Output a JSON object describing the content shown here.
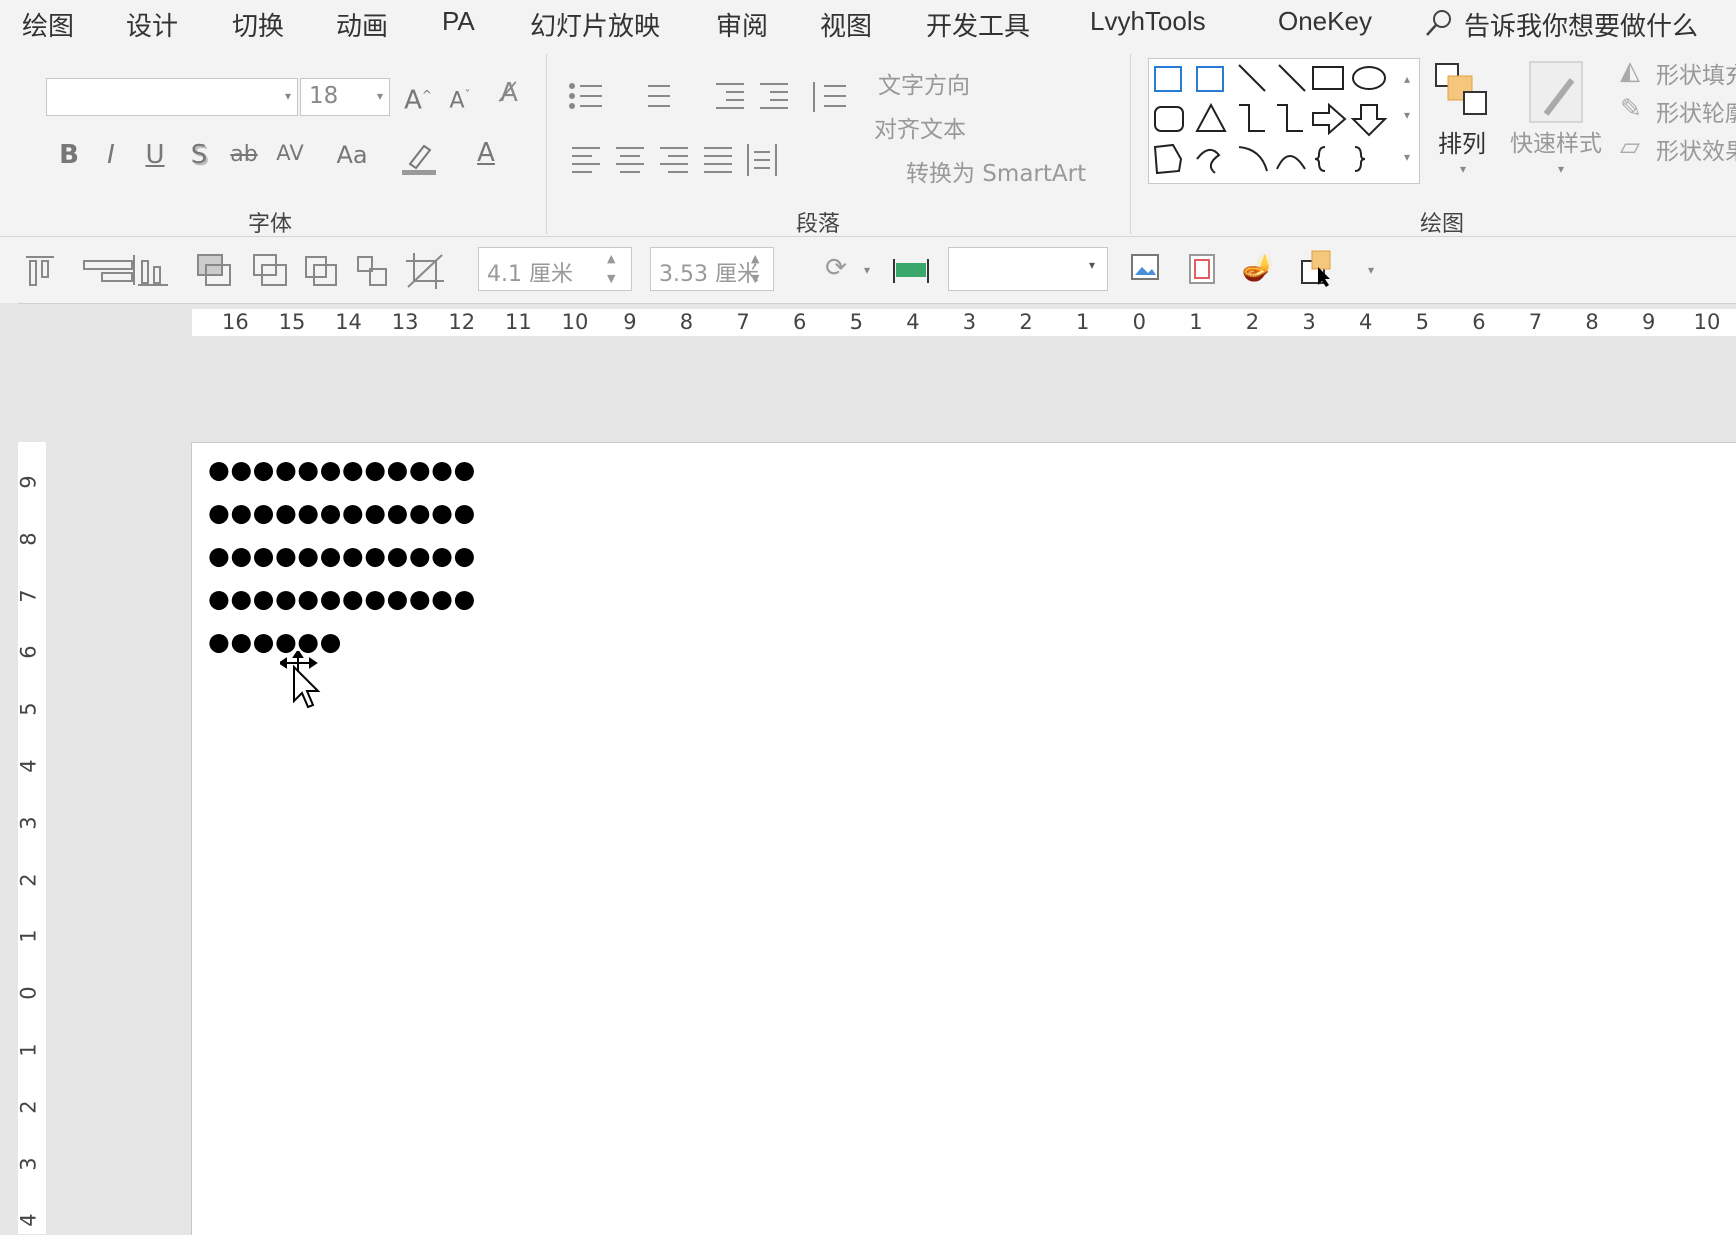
{
  "tabs": [
    "绘图",
    "设计",
    "切换",
    "动画",
    "PA",
    "幻灯片放映",
    "审阅",
    "视图",
    "开发工具",
    "LvyhTools",
    "OneKey"
  ],
  "tell_me": "告诉我你想要做什么",
  "font_group": {
    "font_name": "",
    "font_size": "18",
    "label": "字体",
    "buttons": [
      "B",
      "I",
      "U",
      "S",
      "ab",
      "AV",
      "Aa",
      "A"
    ]
  },
  "paragraph_group": {
    "label": "段落",
    "text_direction": "文字方向",
    "align_text": "对齐文本",
    "smartart": "转换为 SmartArt"
  },
  "drawing_group": {
    "label": "绘图",
    "arrange": "排列",
    "quick_styles": "快速样式",
    "shape_fill": "形状填充",
    "shape_outline": "形状轮廓",
    "shape_effects": "形状效果"
  },
  "format_bar": {
    "height_value": "4.1 厘米",
    "width_value": "3.53 厘米",
    "dropdown_value": ""
  },
  "hruler_labels": [
    "16",
    "15",
    "14",
    "13",
    "12",
    "11",
    "10",
    "9",
    "8",
    "7",
    "6",
    "5",
    "4",
    "3",
    "2",
    "1",
    "0",
    "1",
    "2",
    "3",
    "4",
    "5",
    "6",
    "7",
    "8",
    "9",
    "10"
  ],
  "vruler_labels": [
    "9",
    "8",
    "7",
    "6",
    "5",
    "4",
    "3",
    "2",
    "1",
    "0",
    "1",
    "2",
    "3",
    "4"
  ],
  "slide_text_lines": [
    "●●●●●●●●●●●●",
    "●●●●●●●●●●●●",
    "●●●●●●●●●●●●",
    "●●●●●●●●●●●●",
    "●●●●●●"
  ],
  "colors": {
    "ribbon_bg": "#f3f3f3",
    "workspace_bg": "#e6e6e6",
    "slide_bg": "#ffffff",
    "accent_orange": "#f0b040",
    "accent_blue": "#2a7bd4"
  }
}
